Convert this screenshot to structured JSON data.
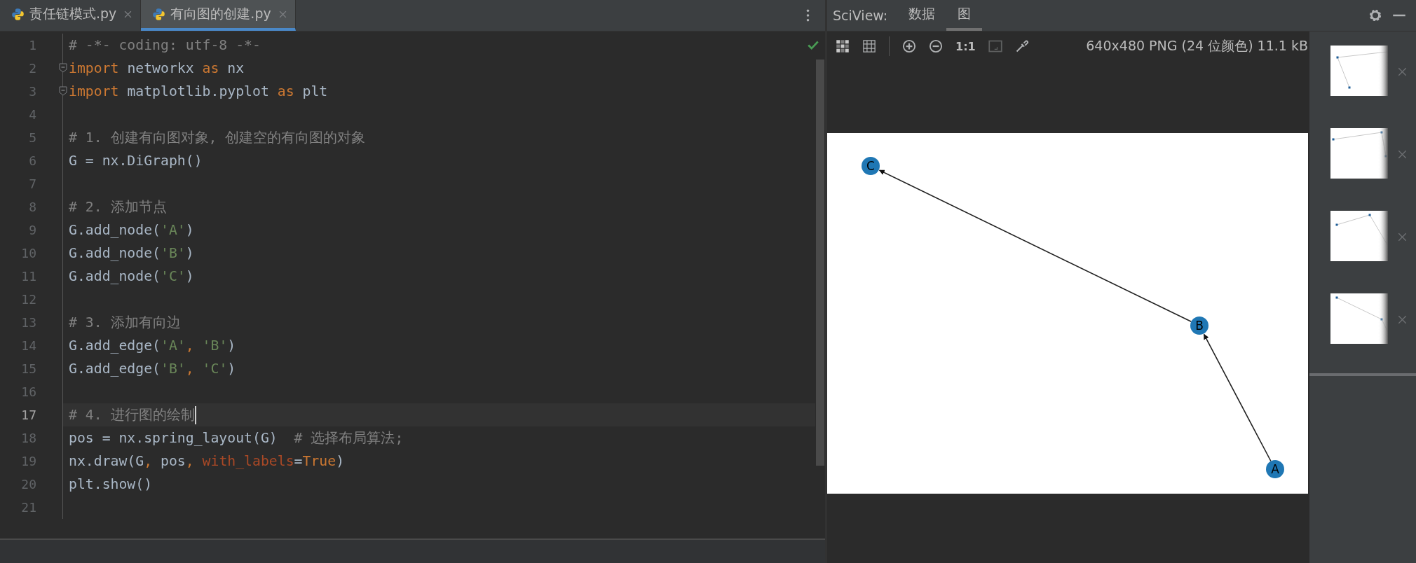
{
  "editor_tabs": [
    {
      "label": "责任链模式.py",
      "selected": false
    },
    {
      "label": "有向图的创建.py",
      "selected": true
    }
  ],
  "editor": {
    "lines": [
      {
        "number": "1",
        "current": false,
        "fold": false,
        "tokens": [
          {
            "kind": "comment",
            "text": "# -*- coding: utf-8 -*-"
          }
        ]
      },
      {
        "number": "2",
        "current": false,
        "fold": true,
        "tokens": [
          {
            "kind": "keyword",
            "text": "import"
          },
          {
            "kind": "plain",
            "text": " networkx "
          },
          {
            "kind": "keyword",
            "text": "as"
          },
          {
            "kind": "plain",
            "text": " nx"
          }
        ]
      },
      {
        "number": "3",
        "current": false,
        "fold": true,
        "tokens": [
          {
            "kind": "keyword",
            "text": "import"
          },
          {
            "kind": "plain",
            "text": " matplotlib.pyplot "
          },
          {
            "kind": "keyword",
            "text": "as"
          },
          {
            "kind": "plain",
            "text": " plt"
          }
        ]
      },
      {
        "number": "4",
        "current": false,
        "fold": false
      },
      {
        "number": "5",
        "current": false,
        "fold": false,
        "tokens": [
          {
            "kind": "comment",
            "text": "# 1. 创建有向图对象, 创建空的有向图的对象"
          }
        ]
      },
      {
        "number": "6",
        "current": false,
        "fold": false,
        "tokens": [
          {
            "kind": "plain",
            "text": "G = nx.DiGraph()"
          }
        ]
      },
      {
        "number": "7",
        "current": false,
        "fold": false
      },
      {
        "number": "8",
        "current": false,
        "fold": false,
        "tokens": [
          {
            "kind": "comment",
            "text": "# 2. 添加节点"
          }
        ]
      },
      {
        "number": "9",
        "current": false,
        "fold": false,
        "tokens": [
          {
            "kind": "plain",
            "text": "G.add_node("
          },
          {
            "kind": "string",
            "text": "'A'"
          },
          {
            "kind": "plain",
            "text": ")"
          }
        ]
      },
      {
        "number": "10",
        "current": false,
        "fold": false,
        "tokens": [
          {
            "kind": "plain",
            "text": "G.add_node("
          },
          {
            "kind": "string",
            "text": "'B'"
          },
          {
            "kind": "plain",
            "text": ")"
          }
        ]
      },
      {
        "number": "11",
        "current": false,
        "fold": false,
        "tokens": [
          {
            "kind": "plain",
            "text": "G.add_node("
          },
          {
            "kind": "string",
            "text": "'C'"
          },
          {
            "kind": "plain",
            "text": ")"
          }
        ]
      },
      {
        "number": "12",
        "current": false,
        "fold": false
      },
      {
        "number": "13",
        "current": false,
        "fold": false,
        "tokens": [
          {
            "kind": "comment",
            "text": "# 3. 添加有向边"
          }
        ]
      },
      {
        "number": "14",
        "current": false,
        "fold": false,
        "tokens": [
          {
            "kind": "plain",
            "text": "G.add_edge("
          },
          {
            "kind": "string",
            "text": "'A'"
          },
          {
            "kind": "keyword",
            "text": ", "
          },
          {
            "kind": "string",
            "text": "'B'"
          },
          {
            "kind": "plain",
            "text": ")"
          }
        ]
      },
      {
        "number": "15",
        "current": false,
        "fold": false,
        "tokens": [
          {
            "kind": "plain",
            "text": "G.add_edge("
          },
          {
            "kind": "string",
            "text": "'B'"
          },
          {
            "kind": "keyword",
            "text": ", "
          },
          {
            "kind": "string",
            "text": "'C'"
          },
          {
            "kind": "plain",
            "text": ")"
          }
        ]
      },
      {
        "number": "16",
        "current": false,
        "fold": false
      },
      {
        "number": "17",
        "current": true,
        "fold": false,
        "tokens": [
          {
            "kind": "comment",
            "text": "# 4. 进行图的绘制"
          }
        ]
      },
      {
        "number": "18",
        "current": false,
        "fold": false,
        "tokens": [
          {
            "kind": "plain",
            "text": "pos = nx.spring_layout(G)  "
          },
          {
            "kind": "comment",
            "text": "# 选择布局算法;"
          }
        ]
      },
      {
        "number": "19",
        "current": false,
        "fold": false,
        "tokens": [
          {
            "kind": "plain",
            "text": "nx.draw(G"
          },
          {
            "kind": "keyword",
            "text": ", "
          },
          {
            "kind": "plain",
            "text": "pos"
          },
          {
            "kind": "keyword",
            "text": ", "
          },
          {
            "kind": "param",
            "text": "with_labels"
          },
          {
            "kind": "plain",
            "text": "="
          },
          {
            "kind": "keyword",
            "text": "True"
          },
          {
            "kind": "plain",
            "text": ")"
          }
        ]
      },
      {
        "number": "20",
        "current": false,
        "fold": false,
        "tokens": [
          {
            "kind": "plain",
            "text": "plt.show()"
          }
        ]
      },
      {
        "number": "21",
        "current": false,
        "fold": false
      }
    ]
  },
  "sciview": {
    "title": "SciView:",
    "tabs": [
      {
        "label": "数据",
        "selected": false
      },
      {
        "label": "图",
        "selected": true
      }
    ],
    "toolbar": {
      "actual_size_label": "1:1",
      "image_info": "640x480 PNG (24 位颜色) 11.1 kB"
    },
    "plot": {
      "nodes": [
        {
          "label": "A"
        },
        {
          "label": "B"
        },
        {
          "label": "C"
        }
      ]
    }
  }
}
